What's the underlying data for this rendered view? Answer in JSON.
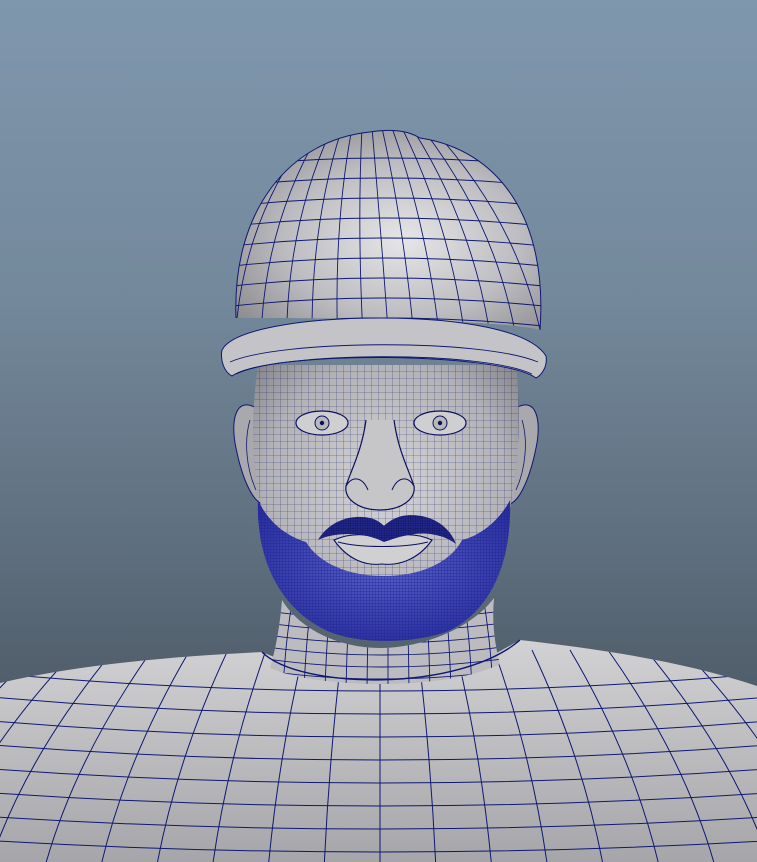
{
  "viewport": {
    "background_top": "#7f97ad",
    "background_bottom": "#3f4852"
  },
  "model": {
    "surface_color": "#b7b7bb",
    "surface_highlight": "#e4e4e6",
    "surface_shadow": "#7d7d82",
    "wireframe_color": "#0e1870",
    "selected_color": "#1c21b4",
    "parts": [
      "helmet",
      "helmet-brim",
      "head",
      "ear-left",
      "ear-right",
      "eye-left",
      "eye-right",
      "nose",
      "mustache",
      "beard",
      "neck",
      "collar",
      "torso"
    ]
  }
}
